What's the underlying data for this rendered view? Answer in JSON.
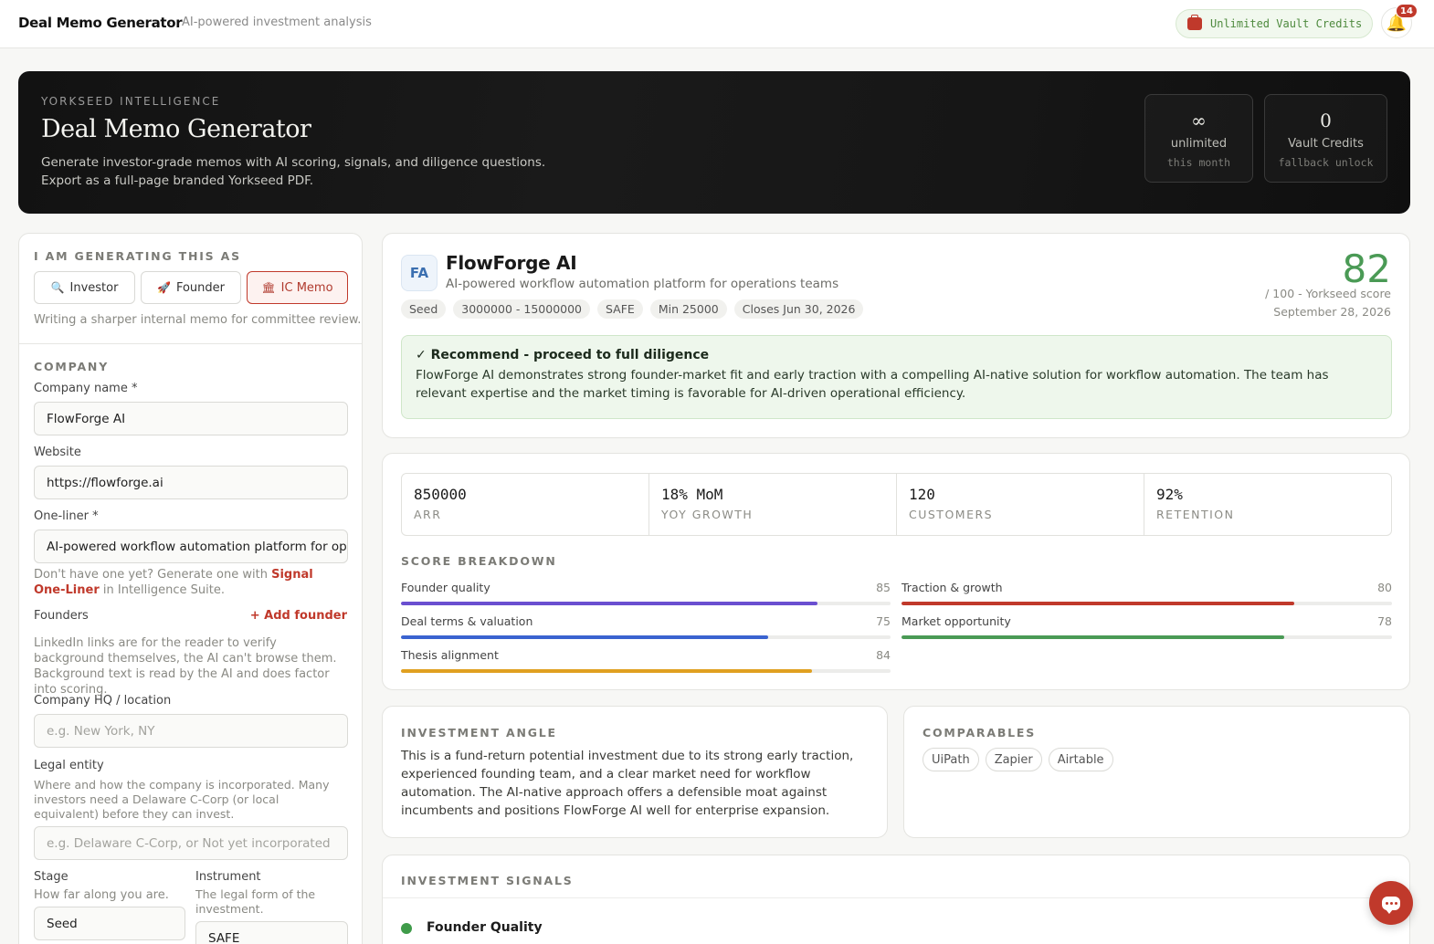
{
  "topbar": {
    "brand": "Deal Memo Generator",
    "dot": ".",
    "tagline": "AI-powered investment analysis",
    "credits_pill": "Unlimited Vault Credits",
    "notification_count": "14"
  },
  "hero": {
    "kicker": "YORKSEED INTELLIGENCE",
    "title": "Deal Memo Generator",
    "subtitle": "Generate investor-grade memos with AI scoring, signals, and diligence questions. Export as a full-page branded Yorkseed PDF.",
    "stats": [
      {
        "big": "∞",
        "label": "unlimited",
        "mono": "this month"
      },
      {
        "big": "0",
        "label": "Vault Credits",
        "mono": "fallback unlock"
      }
    ]
  },
  "form": {
    "role_label": "I AM GENERATING THIS AS",
    "roles": [
      {
        "icon": "🔍",
        "label": "Investor"
      },
      {
        "icon": "🚀",
        "label": "Founder"
      },
      {
        "icon": "🏛",
        "label": "IC Memo"
      }
    ],
    "role_hint": "Writing a sharper internal memo for committee review.",
    "company_section": "COMPANY",
    "company_name_label": "Company name *",
    "company_name_value": "FlowForge AI",
    "website_label": "Website",
    "website_value": "https://flowforge.ai",
    "oneliner_label": "One-liner *",
    "oneliner_value": "AI-powered workflow automation platform for ope",
    "oneliner_hint_pre": "Don't have one yet? Generate one with ",
    "oneliner_hint_link": "Signal One-Liner",
    "oneliner_hint_post": " in Intelligence Suite.",
    "founders_label": "Founders",
    "add_founder": "+ Add founder",
    "founders_hint": "LinkedIn links are for the reader to verify background themselves, the AI can't browse them. Background text is read by the AI and does factor into scoring.",
    "hq_label": "Company HQ / location",
    "hq_placeholder": "e.g. New York, NY",
    "legal_label": "Legal entity",
    "legal_hint": "Where and how the company is incorporated. Many investors need a Delaware C-Corp (or local equivalent) before they can invest.",
    "legal_placeholder": "e.g. Delaware C-Corp, or Not yet incorporated",
    "stage_label": "Stage",
    "stage_hint": "How far along you are.",
    "stage_value": "Seed",
    "instrument_label": "Instrument",
    "instrument_hint": "The legal form of the investment.",
    "instrument_value": "SAFE"
  },
  "summary": {
    "logo": "FA",
    "name": "FlowForge AI",
    "one_liner": "AI-powered workflow automation platform for operations teams",
    "tags": [
      "Seed",
      "3000000 - 15000000",
      "SAFE",
      "Min 25000",
      "Closes Jun 30, 2026"
    ],
    "score": "82",
    "score_sub": "/ 100 - Yorkseed score",
    "date": "September 28, 2026",
    "recommendation_title": "✓ Recommend - proceed to full diligence",
    "recommendation_text": "FlowForge AI demonstrates strong founder-market fit and early traction with a compelling AI-native solution for workflow automation. The team has relevant expertise and the market timing is favorable for AI-driven operational efficiency.",
    "score_color": "#4a9a55"
  },
  "metrics": [
    {
      "value": "850000",
      "label": "ARR"
    },
    {
      "value": "18% MoM",
      "label": "YOY GROWTH"
    },
    {
      "value": "120",
      "label": "CUSTOMERS"
    },
    {
      "value": "92%",
      "label": "RETENTION"
    }
  ],
  "breakdown": {
    "label": "SCORE BREAKDOWN",
    "items": [
      {
        "label": "Founder quality",
        "score": "85",
        "pct": 85,
        "color": "#6a4fd0"
      },
      {
        "label": "Traction & growth",
        "score": "80",
        "pct": 80,
        "color": "#c0392b"
      },
      {
        "label": "Deal terms & valuation",
        "score": "75",
        "pct": 75,
        "color": "#3a63d0"
      },
      {
        "label": "Market opportunity",
        "score": "78",
        "pct": 78,
        "color": "#4a9a55"
      },
      {
        "label": "Thesis alignment",
        "score": "84",
        "pct": 84,
        "color": "#e0a020"
      }
    ]
  },
  "angle": {
    "label": "INVESTMENT ANGLE",
    "text": "This is a fund-return potential investment due to its strong early traction, experienced founding team, and a clear market need for workflow automation. The AI-native approach offers a defensible moat against incumbents and positions FlowForge AI well for enterprise expansion."
  },
  "comparables": {
    "label": "COMPARABLES",
    "items": [
      "UiPath",
      "Zapier",
      "Airtable"
    ]
  },
  "signals": {
    "label": "INVESTMENT SIGNALS",
    "first_title": "Founder Quality"
  }
}
